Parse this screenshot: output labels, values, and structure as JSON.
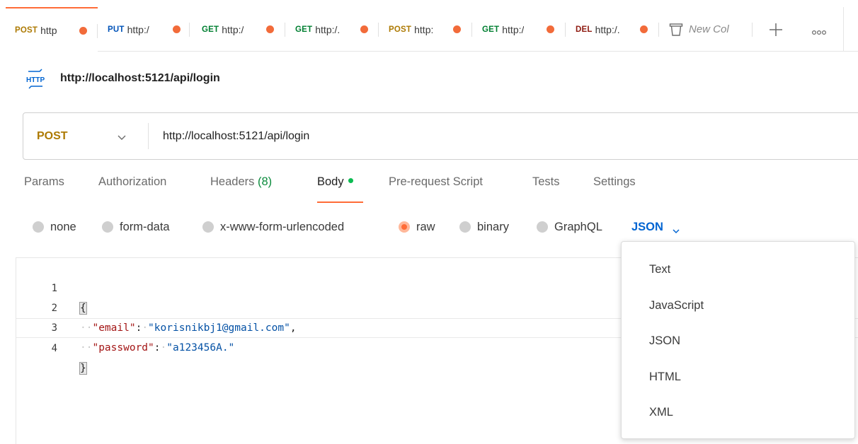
{
  "tabs": [
    {
      "method": "POST",
      "url": "http",
      "method_class": "m-post"
    },
    {
      "method": "PUT",
      "url": "http:/",
      "method_class": "m-put"
    },
    {
      "method": "GET",
      "url": "http:/",
      "method_class": "m-get"
    },
    {
      "method": "GET",
      "url": "http:/.",
      "method_class": "m-get"
    },
    {
      "method": "POST",
      "url": "http:",
      "method_class": "m-post"
    },
    {
      "method": "GET",
      "url": "http:/",
      "method_class": "m-get"
    },
    {
      "method": "DEL",
      "url": "http:/.",
      "method_class": "m-del"
    }
  ],
  "new_tab_label": "New Col",
  "request": {
    "title": "http://localhost:5121/api/login",
    "method": "POST",
    "url": "http://localhost:5121/api/login"
  },
  "request_tabs": {
    "params": "Params",
    "authorization": "Authorization",
    "headers": "Headers",
    "headers_count": "(8)",
    "body": "Body",
    "prerequest": "Pre-request Script",
    "tests": "Tests",
    "settings": "Settings"
  },
  "body_types": {
    "none": "none",
    "form_data": "form-data",
    "urlencoded": "x-www-form-urlencoded",
    "raw": "raw",
    "binary": "binary",
    "graphql": "GraphQL",
    "selected": "raw",
    "format": "JSON"
  },
  "editor": {
    "line_numbers": [
      "1",
      "2",
      "3",
      "4"
    ],
    "open_brace": "{",
    "close_brace": "}",
    "email_key": "\"email\"",
    "email_value": "\"korisnikbj1@gmail.com\"",
    "password_key": "\"password\"",
    "password_value": "\"a123456A.\""
  },
  "format_options": [
    "Text",
    "JavaScript",
    "JSON",
    "HTML",
    "XML"
  ],
  "colors": {
    "accent": "#ff6c37",
    "unsaved_dot": "#f26b3a",
    "post": "#ad7a03",
    "get": "#007f31",
    "put": "#0053b8",
    "delete": "#8e1a10",
    "link_blue": "#0265d2"
  },
  "icons": {
    "http": "http-request-icon",
    "new_collection": "collection-icon",
    "plus": "plus-icon",
    "more": "more-horizontal-icon",
    "chevron": "chevron-down-icon"
  }
}
